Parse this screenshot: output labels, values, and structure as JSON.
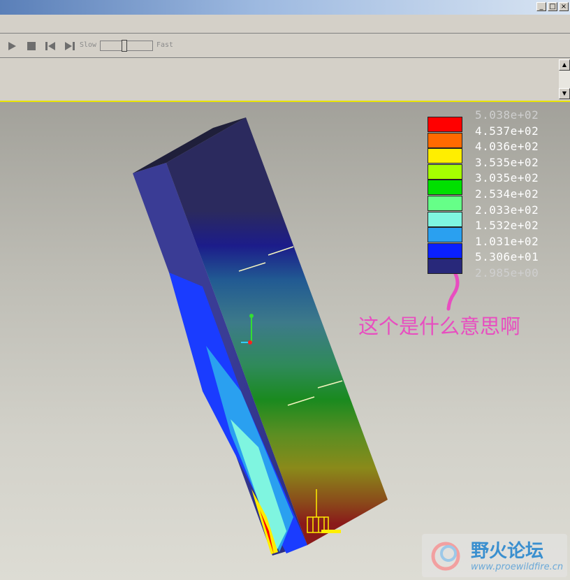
{
  "window": {
    "controls": {
      "minimize": "_",
      "maximize": "□",
      "close": "×"
    }
  },
  "toolbar": {
    "icons": [
      "play-icon",
      "stop-icon",
      "rewind-icon",
      "step-forward-icon"
    ],
    "slow_label": "Slow",
    "fast_label": "Fast",
    "speed_level": 0.45
  },
  "scrollbar": {
    "up": "▲",
    "down": "▼"
  },
  "legend": {
    "colors": [
      "#ff0000",
      "#ff6a00",
      "#ffee00",
      "#a6ff00",
      "#00e000",
      "#66ff88",
      "#7ff5e0",
      "#2aa0f0",
      "#0a20ff",
      "#28287a"
    ],
    "values": [
      "5.038e+02",
      "4.537e+02",
      "4.036e+02",
      "3.535e+02",
      "3.035e+02",
      "2.534e+02",
      "2.033e+02",
      "1.532e+02",
      "1.031e+02",
      "5.306e+01",
      "2.985e+00"
    ]
  },
  "annotation": {
    "text": "这个是什么意思啊",
    "color": "#e84dc0"
  },
  "watermark": {
    "title": "野火论坛",
    "url": "www.proewildfire.cn"
  }
}
